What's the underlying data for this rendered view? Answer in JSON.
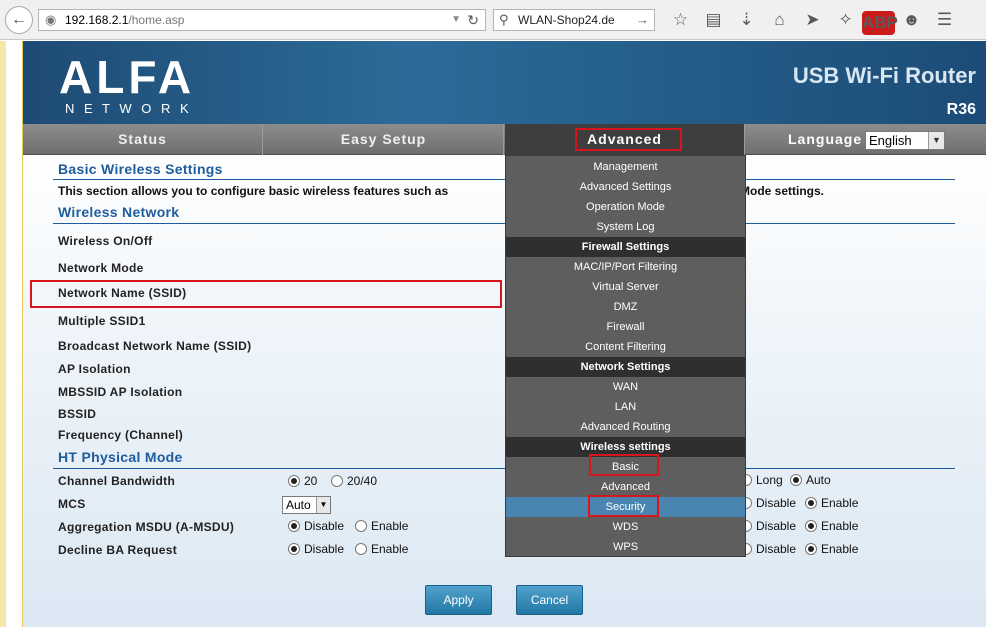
{
  "browser": {
    "url_host": "192.168.2.1",
    "url_path": "/home.asp",
    "search_text": "WLAN-Shop24.de",
    "abp_label": "ABP"
  },
  "header": {
    "logo_text": "ALFA",
    "logo_subtext": "N E T W O R K",
    "product_name": "USB Wi-Fi Router",
    "model": "R36"
  },
  "nav": {
    "tabs": [
      "Status",
      "Easy Setup",
      "Advanced"
    ],
    "language_label": "Language",
    "language_value": "English"
  },
  "dropdown": {
    "items": [
      {
        "label": "Management",
        "type": "item"
      },
      {
        "label": "Advanced Settings",
        "type": "item"
      },
      {
        "label": "Operation Mode",
        "type": "item"
      },
      {
        "label": "System Log",
        "type": "item"
      },
      {
        "label": "Firewall Settings",
        "type": "header"
      },
      {
        "label": "MAC/IP/Port Filtering",
        "type": "item"
      },
      {
        "label": "Virtual Server",
        "type": "item"
      },
      {
        "label": "DMZ",
        "type": "item"
      },
      {
        "label": "Firewall",
        "type": "item"
      },
      {
        "label": "Content Filtering",
        "type": "item"
      },
      {
        "label": "Network Settings",
        "type": "header"
      },
      {
        "label": "WAN",
        "type": "item"
      },
      {
        "label": "LAN",
        "type": "item"
      },
      {
        "label": "Advanced Routing",
        "type": "item"
      },
      {
        "label": "Wireless settings",
        "type": "header"
      },
      {
        "label": "Basic",
        "type": "item"
      },
      {
        "label": "Advanced",
        "type": "item"
      },
      {
        "label": "Security",
        "type": "item",
        "highlighted": true
      },
      {
        "label": "WDS",
        "type": "item"
      },
      {
        "label": "WPS",
        "type": "item"
      }
    ]
  },
  "content": {
    "title": "Basic Wireless Settings",
    "description_left": "This section allows you to configure basic wireless features such as",
    "description_right": "Mode settings.",
    "wireless_network_title": "Wireless Network",
    "rows": [
      "Wireless On/Off",
      "Network Mode",
      "Network Name (SSID)",
      "Multiple SSID1",
      "Broadcast Network Name (SSID)",
      "AP Isolation",
      "MBSSID AP Isolation",
      "BSSID",
      "Frequency (Channel)"
    ],
    "ht_title": "HT Physical Mode",
    "ht_rows": [
      "Channel Bandwidth",
      "MCS",
      "Aggregation MSDU (A-MSDU)",
      "Decline BA Request"
    ],
    "channel_bw": {
      "opt1": "20",
      "opt2": "20/40"
    },
    "mcs_value": "Auto",
    "amsdu": {
      "opt1": "Disable",
      "opt2": "Enable"
    },
    "decline_ba": {
      "opt1": "Disable",
      "opt2": "Enable"
    },
    "right_col": {
      "guard": {
        "opt1": "Long",
        "opt2": "Auto"
      },
      "row2": {
        "opt1": "Disable",
        "opt2": "Enable"
      },
      "row3": {
        "opt1": "Disable",
        "opt2": "Enable"
      },
      "row4": {
        "opt1": "Disable",
        "opt2": "Enable"
      }
    },
    "apply_label": "Apply",
    "cancel_label": "Cancel"
  },
  "colors": {
    "accent_blue": "#1f5c9e",
    "highlight_red": "#d8141c",
    "nav_gray": "#7a7a7a",
    "dropdown_bg": "#5e5e5e",
    "button_blue": "#2478a6"
  }
}
